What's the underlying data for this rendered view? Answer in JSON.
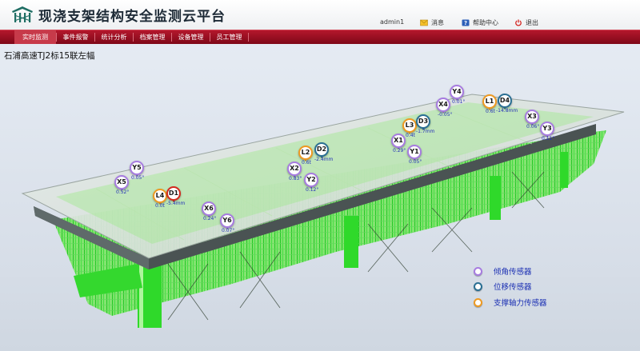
{
  "app": {
    "title": "现浇支架结构安全监测云平台",
    "user": "admin1",
    "links": {
      "messages": "消息",
      "help": "帮助中心",
      "logout": "退出"
    }
  },
  "nav": {
    "items": [
      "实时监测",
      "事件报警",
      "统计分析",
      "档案管理",
      "设备管理",
      "员工管理"
    ]
  },
  "page_title": "石浦高速TJ2标15联左幅",
  "sensors": [
    {
      "code": "Y4",
      "value": "0.01°",
      "type": "tilt"
    },
    {
      "code": "X4",
      "value": "-0.05°",
      "type": "tilt"
    },
    {
      "code": "L1",
      "value": "0.6t",
      "type": "force"
    },
    {
      "code": "D4",
      "value": "-14.8mm",
      "type": "disp"
    },
    {
      "code": "X3",
      "value": "0.06°",
      "type": "tilt"
    },
    {
      "code": "Y3",
      "value": "0.11°",
      "type": "tilt"
    },
    {
      "code": "L3",
      "value": "0.4t",
      "type": "force"
    },
    {
      "code": "D3",
      "value": "-1.7mm",
      "type": "disp"
    },
    {
      "code": "X1",
      "value": "0.29°",
      "type": "tilt"
    },
    {
      "code": "Y1",
      "value": "0.05°",
      "type": "tilt"
    },
    {
      "code": "L2",
      "value": "0.6t",
      "type": "force"
    },
    {
      "code": "D2",
      "value": "-2.4mm",
      "type": "disp"
    },
    {
      "code": "X2",
      "value": "0.83°",
      "type": "tilt"
    },
    {
      "code": "Y2",
      "value": "0.12°",
      "type": "tilt"
    },
    {
      "code": "Y5",
      "value": "0.05°",
      "type": "tilt"
    },
    {
      "code": "X5",
      "value": "0.52°",
      "type": "tilt"
    },
    {
      "code": "L4",
      "value": "0.0t",
      "type": "force"
    },
    {
      "code": "D1",
      "value": "-5.4mm",
      "type": "alarm"
    },
    {
      "code": "X6",
      "value": "0.24°",
      "type": "tilt"
    },
    {
      "code": "Y6",
      "value": "0.07°",
      "type": "tilt"
    }
  ],
  "legend": [
    {
      "label": "倾角传感器",
      "color": "#a77ce0"
    },
    {
      "label": "位移传感器",
      "color": "#2a6f93"
    },
    {
      "label": "支撑轴力传感器",
      "color": "#ee9a22"
    }
  ]
}
